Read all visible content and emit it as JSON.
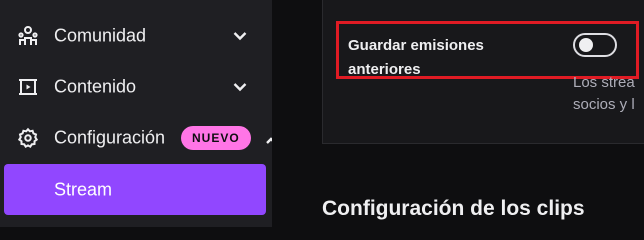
{
  "sidebar": {
    "items": [
      {
        "label": "Comunidad",
        "icon": "community-icon",
        "chevron": "chevron-down-icon"
      },
      {
        "label": "Contenido",
        "icon": "content-icon",
        "chevron": "chevron-down-icon"
      },
      {
        "label": "Configuración",
        "icon": "gear-icon",
        "badge": "NUEVO",
        "chevron": "chevron-up-icon"
      }
    ],
    "active_subitem": {
      "label": "Stream"
    }
  },
  "setting": {
    "label_line1": "Guardar emisiones",
    "label_line2": "anteriores",
    "toggle_on": false,
    "description_line1": "Los strea",
    "description_line2": "socios y l"
  },
  "section": {
    "title": "Configuración de los clips"
  },
  "colors": {
    "accent": "#9147ff",
    "badge": "#ff75e6",
    "highlight": "#e01b24"
  }
}
